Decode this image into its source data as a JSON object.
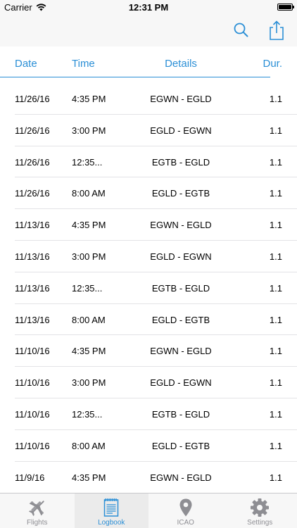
{
  "status_bar": {
    "carrier": "Carrier",
    "time": "12:31 PM"
  },
  "nav": {
    "search_icon": "search-icon",
    "share_icon": "share-icon",
    "accent": "#2b8fd6"
  },
  "columns": {
    "date": "Date",
    "time": "Time",
    "details": "Details",
    "duration": "Dur."
  },
  "rows": [
    {
      "date": "11/26/16",
      "time": "4:35 PM",
      "details": "EGWN - EGLD",
      "duration": "1.1"
    },
    {
      "date": "11/26/16",
      "time": "3:00 PM",
      "details": "EGLD - EGWN",
      "duration": "1.1"
    },
    {
      "date": "11/26/16",
      "time": "12:35...",
      "details": "EGTB - EGLD",
      "duration": "1.1"
    },
    {
      "date": "11/26/16",
      "time": "8:00 AM",
      "details": "EGLD - EGTB",
      "duration": "1.1"
    },
    {
      "date": "11/13/16",
      "time": "4:35 PM",
      "details": "EGWN - EGLD",
      "duration": "1.1"
    },
    {
      "date": "11/13/16",
      "time": "3:00 PM",
      "details": "EGLD - EGWN",
      "duration": "1.1"
    },
    {
      "date": "11/13/16",
      "time": "12:35...",
      "details": "EGTB - EGLD",
      "duration": "1.1"
    },
    {
      "date": "11/13/16",
      "time": "8:00 AM",
      "details": "EGLD - EGTB",
      "duration": "1.1"
    },
    {
      "date": "11/10/16",
      "time": "4:35 PM",
      "details": "EGWN - EGLD",
      "duration": "1.1"
    },
    {
      "date": "11/10/16",
      "time": "3:00 PM",
      "details": "EGLD - EGWN",
      "duration": "1.1"
    },
    {
      "date": "11/10/16",
      "time": "12:35...",
      "details": "EGTB - EGLD",
      "duration": "1.1"
    },
    {
      "date": "11/10/16",
      "time": "8:00 AM",
      "details": "EGLD - EGTB",
      "duration": "1.1"
    },
    {
      "date": "11/9/16",
      "time": "4:35 PM",
      "details": "EGWN - EGLD",
      "duration": "1.1"
    }
  ],
  "tabs": [
    {
      "label": "Flights",
      "icon": "plane-icon",
      "active": false
    },
    {
      "label": "Logbook",
      "icon": "logbook-icon",
      "active": true
    },
    {
      "label": "ICAO",
      "icon": "location-pin-icon",
      "active": false
    },
    {
      "label": "Settings",
      "icon": "gear-icon",
      "active": false
    }
  ]
}
